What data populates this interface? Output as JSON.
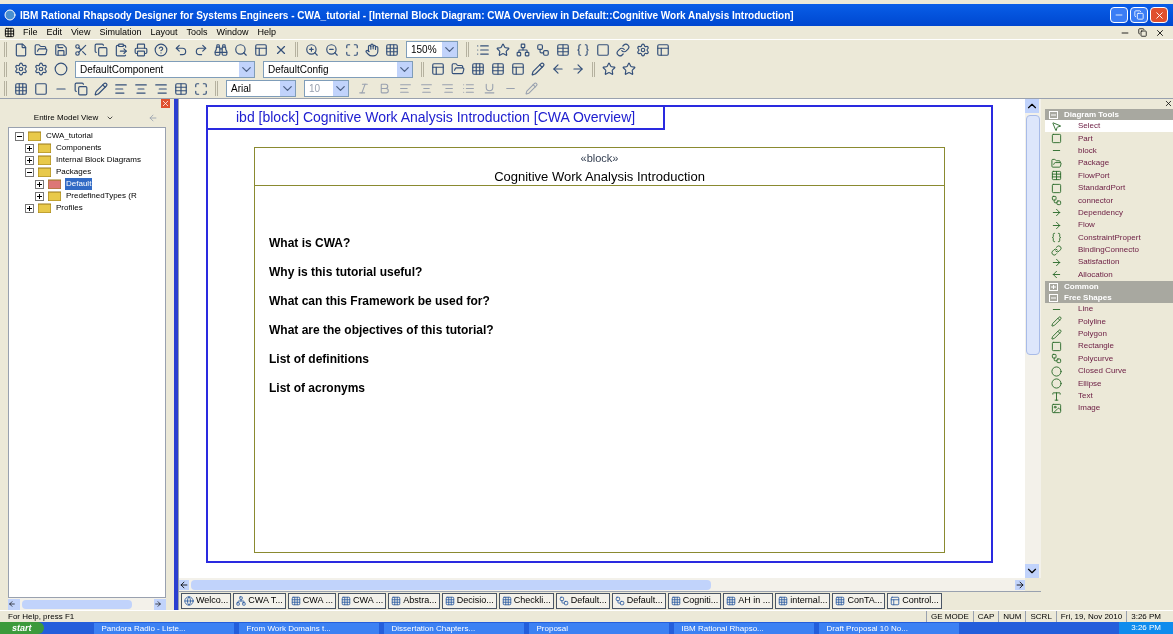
{
  "window": {
    "title": "IBM Rational Rhapsody Designer for Systems Engineers - CWA_tutorial - [Internal Block Diagram: CWA Overview in Default::Cognitive Work Analysis Introduction]"
  },
  "menu": [
    "File",
    "Edit",
    "View",
    "Simulation",
    "Layout",
    "Tools",
    "Window",
    "Help"
  ],
  "toolbar": {
    "zoom": "150%",
    "component": "DefaultComponent",
    "config": "DefaultConfig",
    "font": "Arial",
    "font_size": "10"
  },
  "browser": {
    "view": "Entire Model View",
    "tree": [
      {
        "label": "CWA_tutorial",
        "expanded": true,
        "selected": false,
        "children": [
          {
            "label": "Components",
            "expanded": false,
            "selected": false
          },
          {
            "label": "Internal Block Diagrams",
            "expanded": false,
            "selected": false
          },
          {
            "label": "Packages",
            "expanded": true,
            "selected": false,
            "children": [
              {
                "label": "Default",
                "expanded": false,
                "selected": true
              },
              {
                "label": "PredefinedTypes (R",
                "expanded": false,
                "selected": false
              }
            ]
          },
          {
            "label": "Profiles",
            "expanded": false,
            "selected": false
          }
        ]
      }
    ]
  },
  "diagram": {
    "frame_title": "ibd [block] Cognitive Work Analysis Introduction [CWA Overview]",
    "stereotype": "«block»",
    "block_name": "Cognitive Work Analysis Introduction",
    "items": [
      "What is CWA?",
      "Why is this tutorial useful?",
      "What can this Framework be used for?",
      "What are the objectives of this tutorial?",
      "List of definitions",
      "List of acronyms"
    ]
  },
  "palette": {
    "sections": [
      {
        "title": "Diagram Tools",
        "expanded": true,
        "tools": [
          {
            "label": "Select",
            "kind": "select",
            "selected": true
          },
          {
            "label": "Part",
            "kind": "part",
            "selected": false
          },
          {
            "label": "block",
            "kind": "block",
            "selected": false
          },
          {
            "label": "Package",
            "kind": "package",
            "selected": false
          },
          {
            "label": "FlowPort",
            "kind": "flowport",
            "selected": false
          },
          {
            "label": "StandardPort",
            "kind": "port",
            "selected": false
          },
          {
            "label": "connector",
            "kind": "connector",
            "selected": false
          },
          {
            "label": "Dependency",
            "kind": "dependency",
            "selected": false
          },
          {
            "label": "Flow",
            "kind": "flow",
            "selected": false
          },
          {
            "label": "ConstraintPropert",
            "kind": "constraint",
            "selected": false
          },
          {
            "label": "BindingConnecto",
            "kind": "binding",
            "selected": false
          },
          {
            "label": "Satisfaction",
            "kind": "satisfaction",
            "selected": false
          },
          {
            "label": "Allocation",
            "kind": "allocation",
            "selected": false
          }
        ]
      },
      {
        "title": "Common",
        "expanded": false
      },
      {
        "title": "Free Shapes",
        "expanded": true,
        "tools": [
          {
            "label": "Line",
            "kind": "line",
            "selected": false
          },
          {
            "label": "Polyline",
            "kind": "polyline",
            "selected": false
          },
          {
            "label": "Polygon",
            "kind": "polygon",
            "selected": false
          },
          {
            "label": "Rectangle",
            "kind": "rectangle",
            "selected": false
          },
          {
            "label": "Polycurve",
            "kind": "polycurve",
            "selected": false
          },
          {
            "label": "Closed Curve",
            "kind": "closedcurve",
            "selected": false
          },
          {
            "label": "Ellipse",
            "kind": "ellipse",
            "selected": false
          },
          {
            "label": "Text",
            "kind": "text",
            "selected": false
          },
          {
            "label": "Image",
            "kind": "image",
            "selected": false
          }
        ]
      }
    ]
  },
  "doc_tabs": [
    {
      "label": "Welco...",
      "kind": "globe"
    },
    {
      "label": "CWA T...",
      "kind": "tree"
    },
    {
      "label": "CWA ...",
      "kind": "ibd"
    },
    {
      "label": "CWA ...",
      "kind": "ibd"
    },
    {
      "label": "Abstra...",
      "kind": "ibd"
    },
    {
      "label": "Decisio...",
      "kind": "ibd"
    },
    {
      "label": "Checkli...",
      "kind": "ibd"
    },
    {
      "label": "Default...",
      "kind": "usecase"
    },
    {
      "label": "Default...",
      "kind": "usecase"
    },
    {
      "label": "Cogniti...",
      "kind": "ibd"
    },
    {
      "label": "AH in ...",
      "kind": "ibd"
    },
    {
      "label": "internal...",
      "kind": "ibd"
    },
    {
      "label": "ConTA...",
      "kind": "ibd"
    },
    {
      "label": "Control...",
      "kind": "state"
    }
  ],
  "status_bar": {
    "help": "For Help, press F1",
    "panes": [
      "GE MODE",
      "CAP",
      "NUM",
      "SCRL",
      "Fri, 19, Nov 2010",
      "3:26 PM"
    ]
  },
  "taskbar": {
    "start": "start",
    "items": [
      "Pandora Radio - Liste...",
      "From Work Domains t...",
      "Dissertation Chapters...",
      "Proposal",
      "IBM Rational Rhapso...",
      "Draft Proposal  10 No..."
    ],
    "clock": "3:26 PM"
  }
}
